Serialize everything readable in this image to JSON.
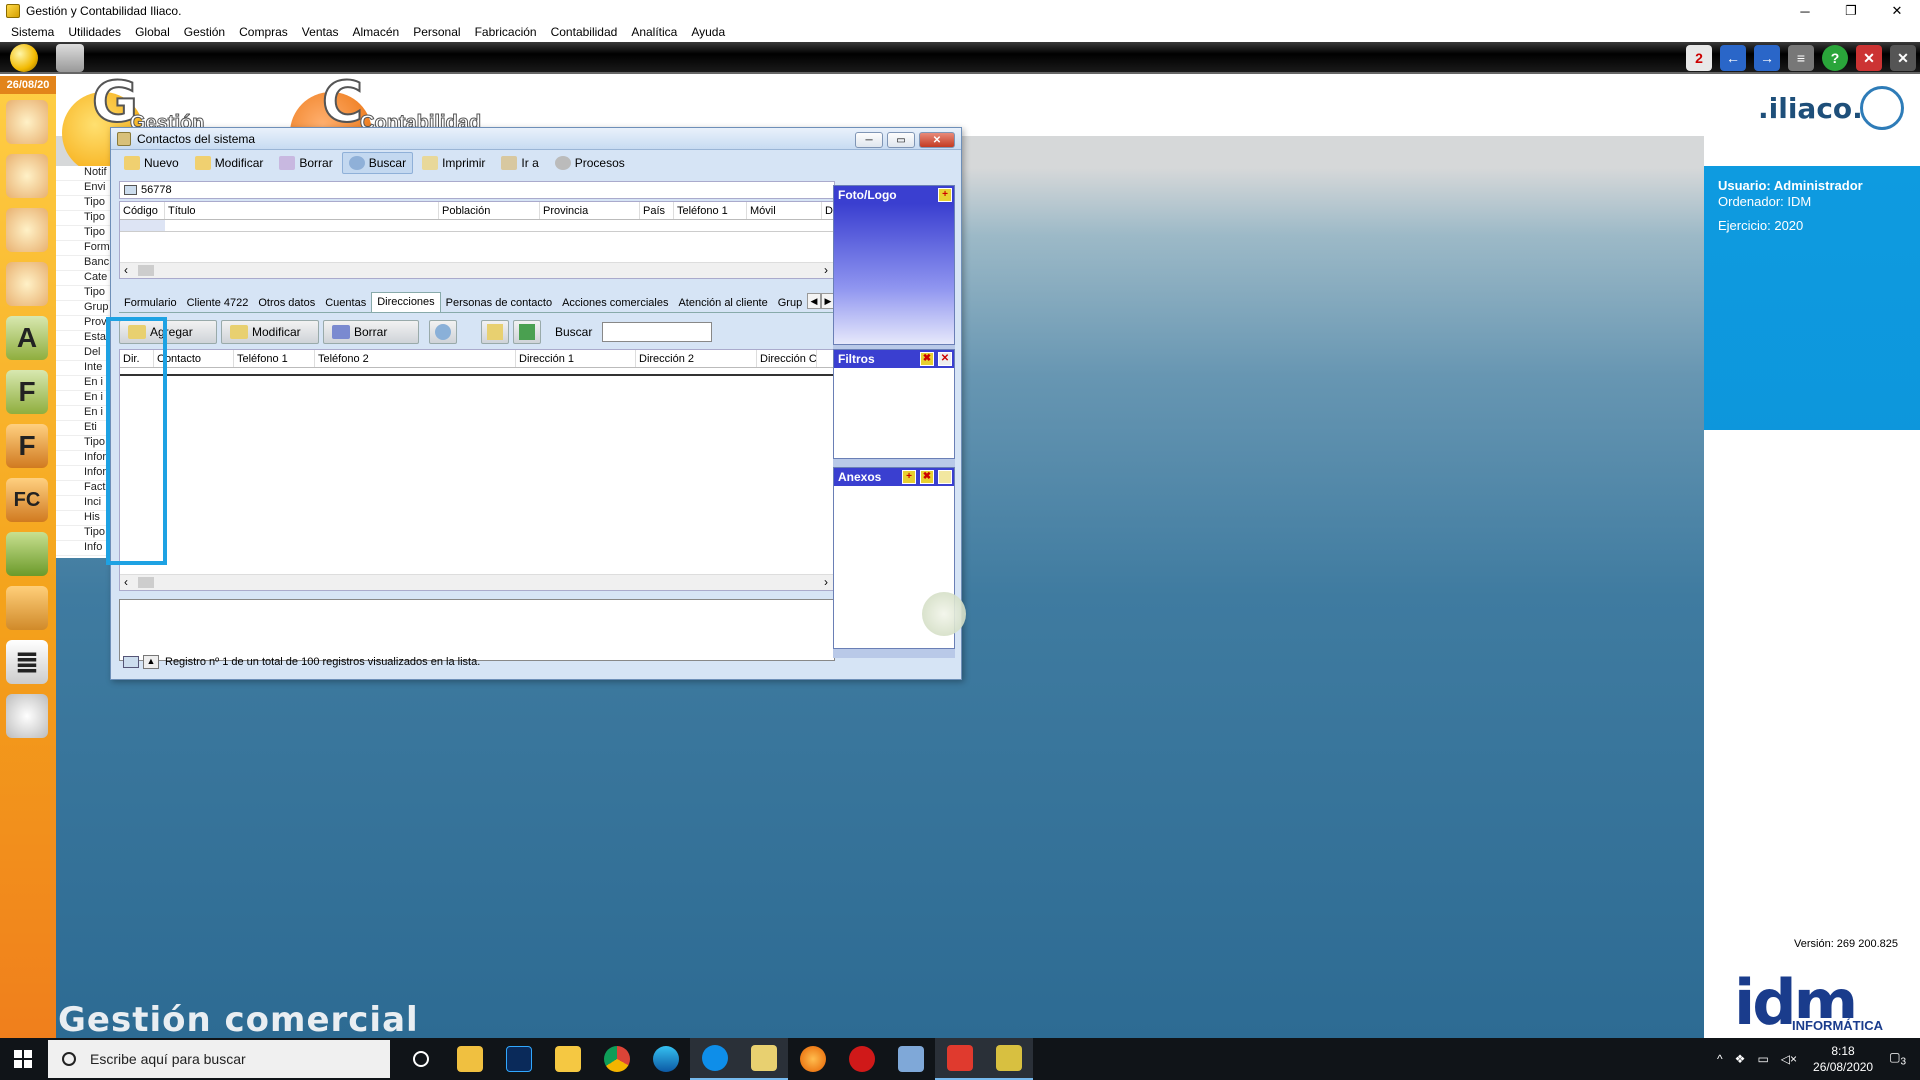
{
  "window": {
    "title": "Gestión y Contabilidad Iliaco.",
    "minimize": "─",
    "maximize": "❐",
    "close": "✕"
  },
  "menu": [
    "Sistema",
    "Utilidades",
    "Global",
    "Gestión",
    "Compras",
    "Ventas",
    "Almacén",
    "Personal",
    "Fabricación",
    "Contabilidad",
    "Analítica",
    "Ayuda"
  ],
  "date_badge": "26/08/20",
  "branding": {
    "gestion_label": "Gestión",
    "contabilidad_label": "Contabilidad",
    "brand": ".iliaco.",
    "footer": "Gestión comercial"
  },
  "left_list": [
    "Notif",
    "Envi",
    "Tipo",
    "Tipo",
    "Tipo",
    "Form",
    "Banc",
    "Cate",
    "Tipo",
    "Grup",
    "Prov",
    "Esta",
    "Del",
    "Inte",
    "En i",
    "En i",
    "En i",
    "Eti",
    "Tipo",
    "Infor",
    "Infor",
    "Fact",
    "Inci",
    "His",
    "Tipo",
    "Info"
  ],
  "user_panel": {
    "usuario": "Usuario: Administrador",
    "ordenador": "Ordenador:  IDM",
    "ejercicio": "Ejercicio: 2020",
    "version": "Versión: 269 200.825",
    "idm_logo": "idm",
    "idm_sub": "INFORMÁTICA"
  },
  "dialog": {
    "title": "Contactos del sistema",
    "toolbar": [
      "Nuevo",
      "Modificar",
      "Borrar",
      "Buscar",
      "Imprimir",
      "Ir a",
      "Procesos"
    ],
    "selected_tool": "Buscar",
    "code": "56778",
    "grid1_headers": [
      "Código",
      "Título",
      "Población",
      "Provincia",
      "País",
      "Teléfono 1",
      "Móvil",
      "D"
    ],
    "tabs": [
      "Formulario",
      "Cliente 4722",
      "Otros datos",
      "Cuentas",
      "Direcciones",
      "Personas de contacto",
      "Acciones comerciales",
      "Atención al cliente",
      "Grup"
    ],
    "active_tab": "Direcciones",
    "sub_buttons": {
      "agregar": "Agregar",
      "modificar": "Modificar",
      "borrar": "Borrar"
    },
    "search_label": "Buscar",
    "search_value": "",
    "grid2_headers": [
      "Dir.",
      "Contacto",
      "Teléfono 1",
      "Teléfono 2",
      "Dirección 1",
      "Dirección 2",
      "Dirección C"
    ],
    "status": "Registro nº 1 de un total de 100 registros visualizados en la lista.",
    "panels": {
      "foto": "Foto/Logo",
      "filtros": "Filtros",
      "anexos": "Anexos"
    }
  },
  "taskbar": {
    "search_placeholder": "Escribe aquí para buscar",
    "time": "8:18",
    "date": "26/08/2020",
    "notif_count": "3"
  },
  "colors": {
    "accent_blue": "#0a9ae0",
    "sidebar_orange": "#f4a21b",
    "highlight": "#1ea2e3",
    "panel_header": "#3a3fd0"
  }
}
